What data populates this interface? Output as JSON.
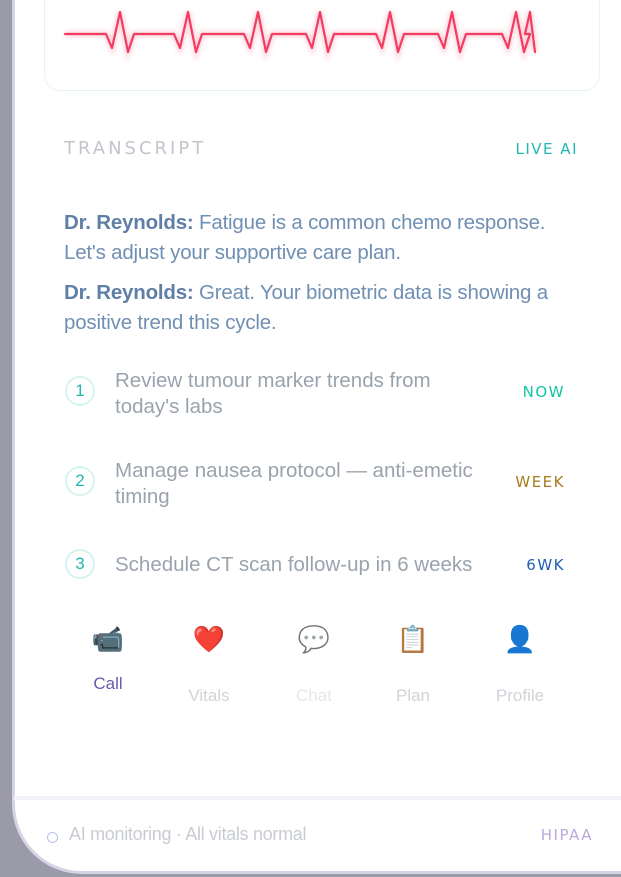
{
  "transcript": {
    "title": "TRANSCRIPT",
    "badge": "LIVE AI",
    "lines": [
      {
        "speaker": "Dr. Reynolds:",
        "text": " Fatigue is a common chemo response. Let's adjust your supportive care plan."
      },
      {
        "speaker": "Dr. Reynolds:",
        "text": " Great. Your biometric data is showing a positive trend this cycle."
      }
    ]
  },
  "tasks": [
    {
      "num": "1",
      "text": "Review tumour marker trends from today's labs",
      "tag": "NOW",
      "tag_color": "#13c4a3"
    },
    {
      "num": "2",
      "text": "Manage nausea protocol — anti-emetic timing",
      "tag": "WEEK",
      "tag_color": "#a67c1c"
    },
    {
      "num": "3",
      "text": "Schedule CT scan follow-up in 6 weeks",
      "tag": "6WK",
      "tag_color": "#1d5fb0"
    }
  ],
  "tabs": [
    {
      "icon": "📹",
      "label": "Call",
      "active": true
    },
    {
      "icon": "❤️",
      "label": "Vitals",
      "active": false
    },
    {
      "icon": "💬",
      "label": "Chat",
      "active": false
    },
    {
      "icon": "📋",
      "label": "Plan",
      "active": false
    },
    {
      "icon": "👤",
      "label": "Profile",
      "active": false
    }
  ],
  "footer": {
    "status": "AI monitoring · All vitals normal",
    "compliance": "HIPAA"
  },
  "colors": {
    "ecg": "#f23d63",
    "accent": "#1fb8b0",
    "active_tab": "#6a58b0"
  }
}
